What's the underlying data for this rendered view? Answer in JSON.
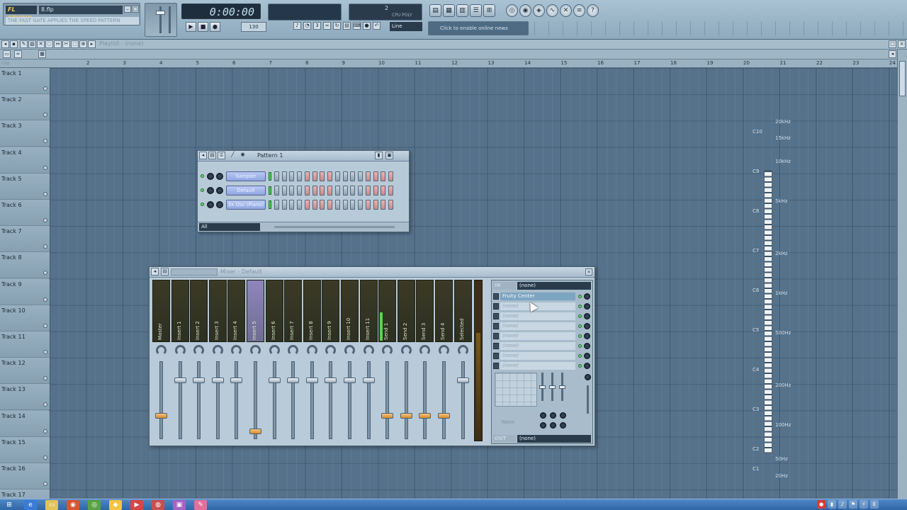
{
  "app": {
    "logo": "FL STUDIO",
    "file_name": "8.flp",
    "hint": "THE FAST GATE APPLIES THE SPEED PATTERN",
    "time": "0:00:00",
    "bpm": "130",
    "cpu": "2",
    "cpu_label": "CPU  POLY",
    "snap": "Line",
    "news": "Click to enable online news"
  },
  "playlist": {
    "title": "Playlist - (none)",
    "corner_label": "Clip",
    "bar_numbers": [
      "2",
      "3",
      "4",
      "5",
      "6",
      "7",
      "8",
      "9",
      "10",
      "11",
      "12",
      "13",
      "14",
      "15",
      "16",
      "17",
      "18",
      "19",
      "20",
      "21",
      "22",
      "23",
      "24"
    ],
    "tracks": [
      "Track 1",
      "Track 2",
      "Track 3",
      "Track 4",
      "Track 5",
      "Track 6",
      "Track 7",
      "Track 8",
      "Track 9",
      "Track 10",
      "Track 11",
      "Track 12",
      "Track 13",
      "Track 14",
      "Track 15",
      "Track 16",
      "Track 17"
    ]
  },
  "pattern": {
    "title": "Pattern 1",
    "filter": "All",
    "channels": [
      "Sampler",
      "Default",
      "3x Osc (Piano)"
    ]
  },
  "mixer": {
    "title": "Mixer - Default",
    "strips": [
      "Master",
      "Insert 1",
      "Insert 2",
      "Insert 3",
      "Insert 4",
      "Insert 5",
      "Insert 6",
      "Insert 7",
      "Insert 8",
      "Insert 9",
      "Insert 10",
      "Insert 11",
      "Send 1",
      "Send 2",
      "Send 3",
      "Send 4",
      "Selected"
    ],
    "input_label": "IN",
    "input_value": "(none)",
    "output_label": "OUT",
    "output_value": "(none)",
    "slots": [
      "Fruity Center",
      "(none)",
      "(none)",
      "(none)",
      "(none)",
      "(none)",
      "(none)",
      "(none)"
    ],
    "eq_preset": "None"
  },
  "piano": {
    "notes": [
      "C10",
      "C9",
      "C8",
      "C7",
      "C6",
      "C5",
      "C4",
      "C3",
      "C2",
      "C1"
    ],
    "freqs": [
      "20kHz",
      "15kHz",
      "10kHz",
      "5kHz",
      "2kHz",
      "1kHz",
      "500Hz",
      "200Hz",
      "100Hz",
      "50Hz",
      "20Hz"
    ]
  },
  "icons": {
    "play": "▶",
    "stop": "■",
    "record": "●",
    "close": "×",
    "start": "⊞"
  }
}
